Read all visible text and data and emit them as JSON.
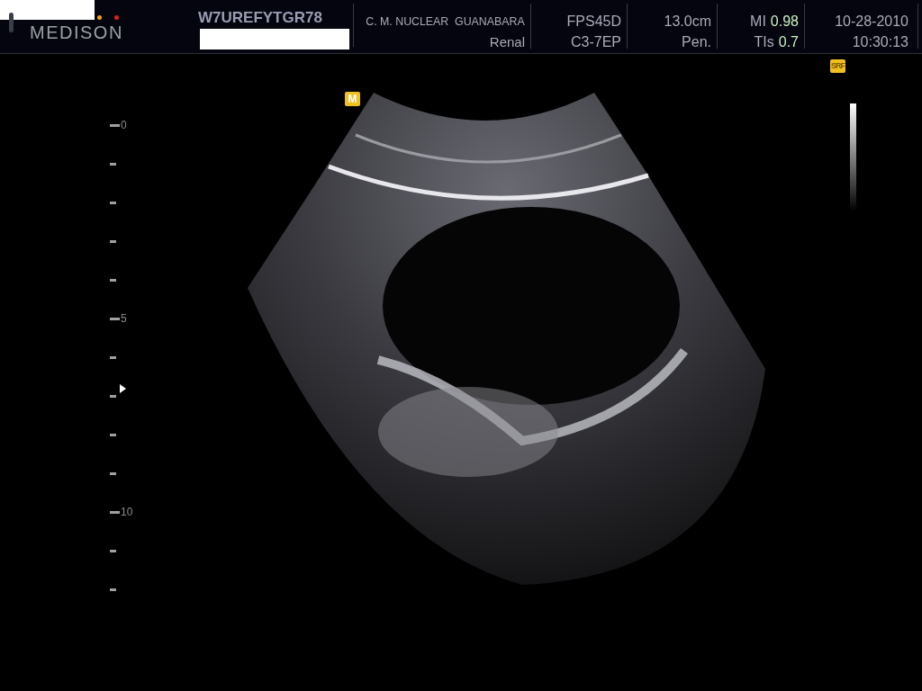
{
  "header": {
    "logo": "MEDISON",
    "patient_id": "W7UREFYTGR78",
    "institution": "C. M. NUCLEAR  GUANABARA",
    "exam": "Renal",
    "preset": "FPS45D",
    "probe": "C3-7EP",
    "depth": "13.0cm",
    "mode": "Pen.",
    "mi_label": "MI",
    "mi_value": "0.98",
    "tis_label": "TIs",
    "tis_value": "0.7",
    "date": "10-28-2010",
    "time": "10:30:13"
  },
  "badges": {
    "srf": "SRF",
    "marker": "M"
  },
  "depth_scale": {
    "ticks": [
      {
        "kind": "major",
        "label": "0"
      },
      {
        "kind": "minor"
      },
      {
        "kind": "minor"
      },
      {
        "kind": "minor"
      },
      {
        "kind": "minor"
      },
      {
        "kind": "major",
        "label": "5"
      },
      {
        "kind": "minor"
      },
      {
        "kind": "minor"
      },
      {
        "kind": "minor"
      },
      {
        "kind": "minor"
      },
      {
        "kind": "major",
        "label": "10"
      },
      {
        "kind": "minor"
      },
      {
        "kind": "minor"
      }
    ]
  }
}
